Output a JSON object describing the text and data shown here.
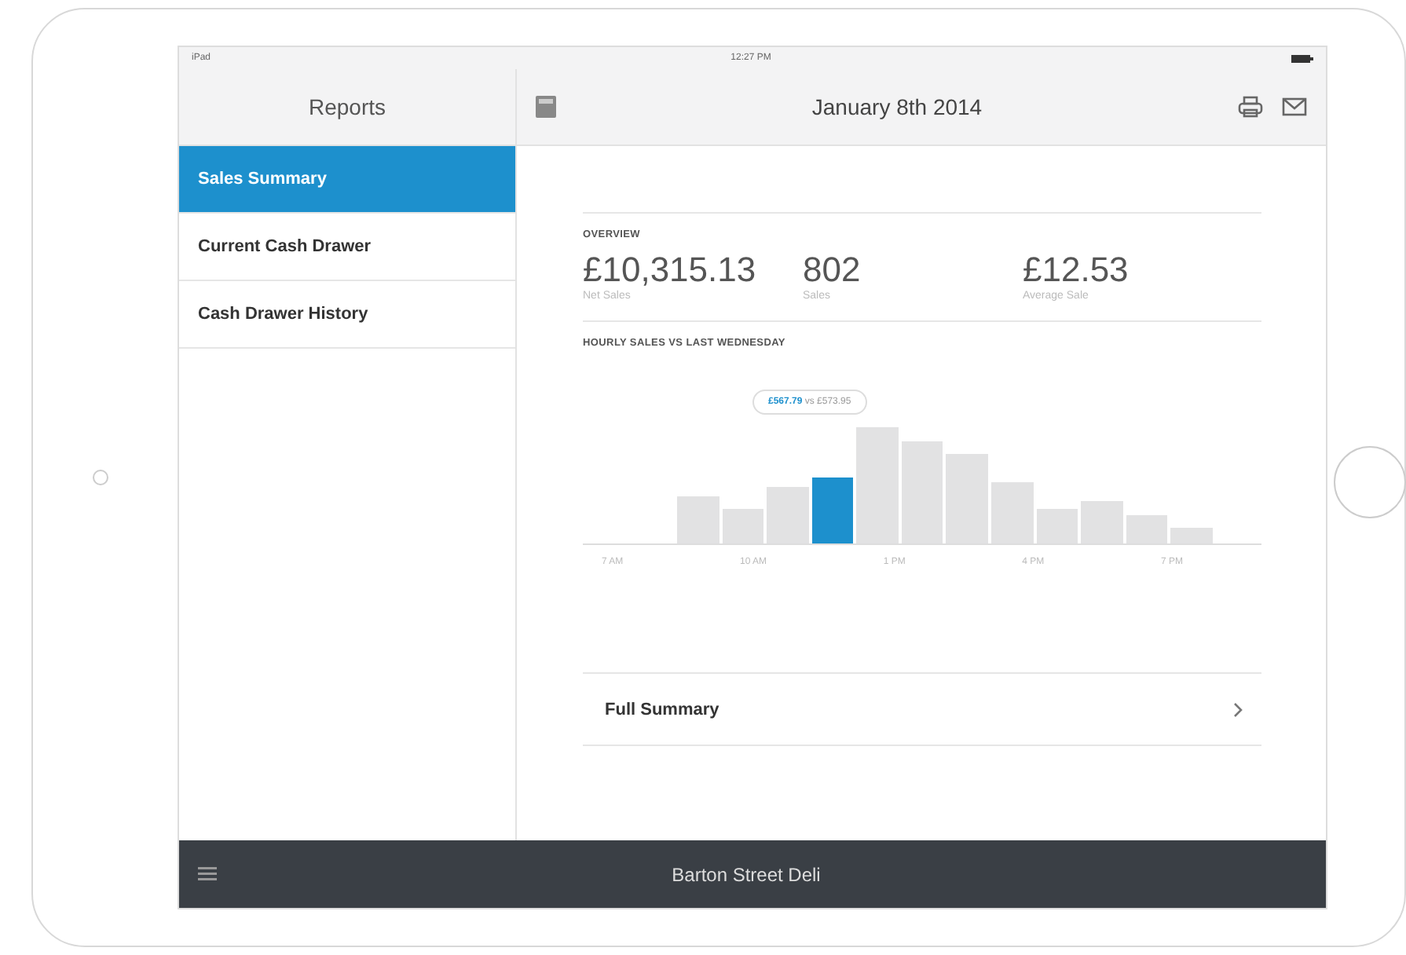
{
  "status_bar": {
    "carrier": "iPad",
    "time": "12:27 PM"
  },
  "sidebar": {
    "title": "Reports",
    "items": [
      {
        "label": "Sales Summary",
        "selected": true
      },
      {
        "label": "Current Cash Drawer",
        "selected": false
      },
      {
        "label": "Cash Drawer History",
        "selected": false
      }
    ]
  },
  "header": {
    "title": "January 8th 2014"
  },
  "overview": {
    "heading": "OVERVIEW",
    "stats": [
      {
        "value": "£10,315.13",
        "label": "Net Sales"
      },
      {
        "value": "802",
        "label": "Sales"
      },
      {
        "value": "£12.53",
        "label": "Average Sale"
      }
    ]
  },
  "hourly_chart": {
    "title": "HOURLY SALES VS LAST WEDNESDAY",
    "tooltip": {
      "value": "£567.79",
      "comparison": "vs £573.95"
    },
    "bars": [
      {
        "selected": false
      },
      {
        "selected": false
      },
      {
        "selected": false
      },
      {
        "selected": true
      },
      {
        "selected": false
      },
      {
        "selected": false
      },
      {
        "selected": false
      },
      {
        "selected": false
      },
      {
        "selected": false
      },
      {
        "selected": false
      },
      {
        "selected": false
      },
      {
        "selected": false
      }
    ],
    "x_labels": [
      "7 AM",
      "10 AM",
      "1 PM",
      "4 PM",
      "7 PM"
    ]
  },
  "full_summary": {
    "label": "Full Summary"
  },
  "bottom_bar": {
    "title": "Barton Street Deli"
  }
}
